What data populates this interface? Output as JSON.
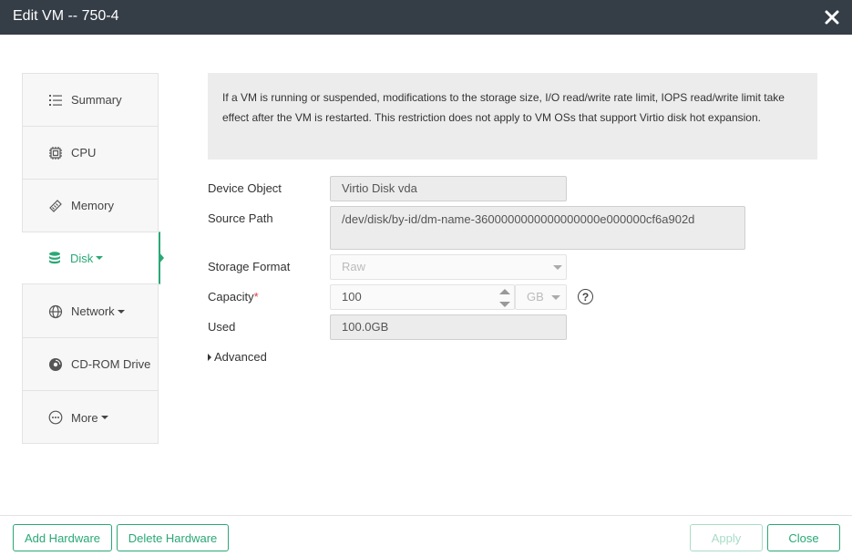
{
  "dialog": {
    "title": "Edit VM -- 750-4"
  },
  "sidebar": {
    "items": [
      {
        "label": "Summary",
        "icon": "list-icon"
      },
      {
        "label": "CPU",
        "icon": "cpu-icon"
      },
      {
        "label": "Memory",
        "icon": "memory-icon"
      },
      {
        "label": "Disk",
        "icon": "database-icon",
        "active": true
      },
      {
        "label": "Network",
        "icon": "globe-icon"
      },
      {
        "label": "CD-ROM Drive",
        "icon": "disc-icon"
      },
      {
        "label": "More",
        "icon": "more-icon"
      }
    ]
  },
  "notice": {
    "text": "If a VM is running or suspended, modifications to the storage size, I/O read/write rate limit, IOPS read/write limit take effect after the VM is restarted. This restriction does not apply to VM OSs that support Virtio disk hot expansion."
  },
  "form": {
    "device_object": {
      "label": "Device Object",
      "value": "Virtio Disk vda"
    },
    "source_path": {
      "label": "Source Path",
      "value": "/dev/disk/by-id/dm-name-3600000000000000000e000000cf6a902d"
    },
    "storage_format": {
      "label": "Storage Format",
      "value": "Raw"
    },
    "capacity": {
      "label": "Capacity",
      "required_mark": "*",
      "value": "100",
      "unit": "GB",
      "help": "?"
    },
    "used": {
      "label": "Used",
      "value": "100.0GB"
    },
    "advanced_label": "Advanced"
  },
  "footer": {
    "add_hardware": "Add Hardware",
    "delete_hardware": "Delete Hardware",
    "apply": "Apply",
    "close": "Close"
  },
  "colors": {
    "accent": "#2aa876",
    "titlebar": "#353d47"
  }
}
